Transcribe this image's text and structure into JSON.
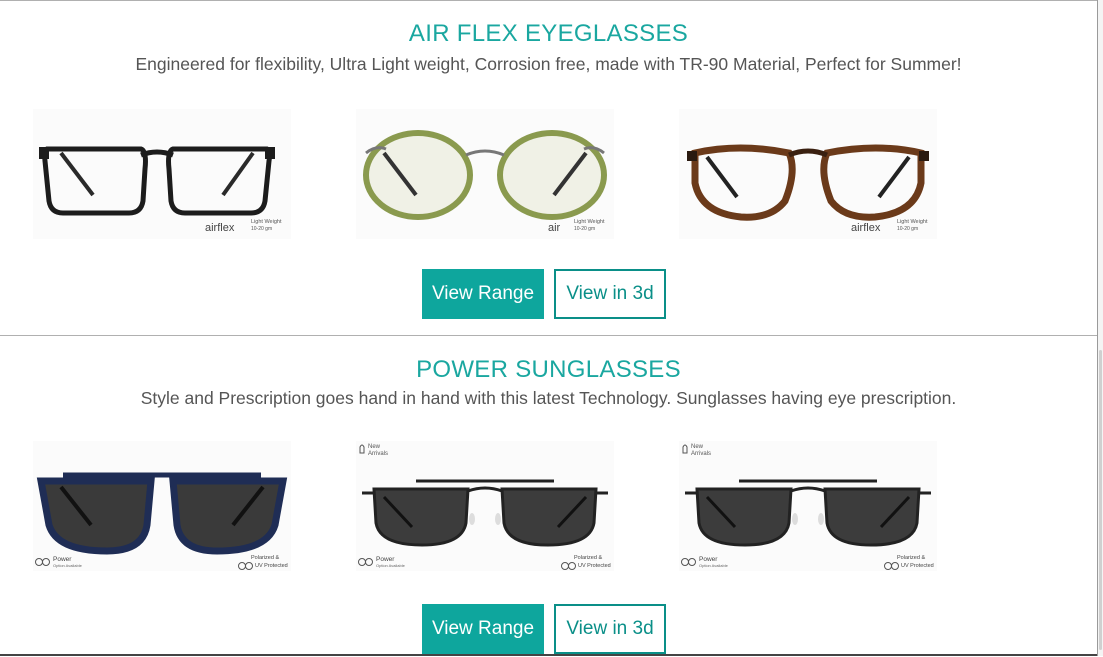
{
  "sections": [
    {
      "title": "AIR FLEX EYEGLASSES",
      "subtitle": "Engineered for flexibility, Ultra Light weight, Corrosion free, made with TR-90 Material, Perfect for Summer!",
      "products": [
        {
          "brand": "airflex",
          "weight_label": "Light Weight",
          "weight_range": "10-20 gm",
          "frame_color": "#1c1c1c"
        },
        {
          "brand": "air",
          "weight_label": "Light Weight",
          "weight_range": "10-20 gm",
          "frame_color": "#8a9a4e"
        },
        {
          "brand": "airflex",
          "weight_label": "Light Weight",
          "weight_range": "10-20 gm",
          "frame_color": "#6b3a1a"
        }
      ],
      "buttons": {
        "primary": "View Range",
        "secondary": "View in 3d"
      }
    },
    {
      "title": "POWER SUNGLASSES",
      "subtitle": "Style and Prescription goes hand in hand with this latest Technology. Sunglasses having eye prescription.",
      "products": [
        {
          "new_badge": "",
          "power_label": "Power",
          "power_sub": "Option Available",
          "polar_label": "Polarized &",
          "polar_sub": "UV Protected",
          "frame_color": "#1f2d55"
        },
        {
          "new_badge": "New Arrivals",
          "new_line1": "New",
          "new_line2": "Arrivals",
          "power_label": "Power",
          "power_sub": "Option Available",
          "polar_label": "Polarized &",
          "polar_sub": "UV Protected",
          "frame_color": "#222222"
        },
        {
          "new_badge": "New Arrivals",
          "new_line1": "New",
          "new_line2": "Arrivals",
          "power_label": "Power",
          "power_sub": "Option Available",
          "polar_label": "Polarized &",
          "polar_sub": "UV Protected",
          "frame_color": "#222222"
        }
      ],
      "buttons": {
        "primary": "View Range",
        "secondary": "View in 3d"
      }
    }
  ],
  "colors": {
    "accent": "#1aa7a0",
    "button": "#0ea69d",
    "text": "#555555"
  }
}
